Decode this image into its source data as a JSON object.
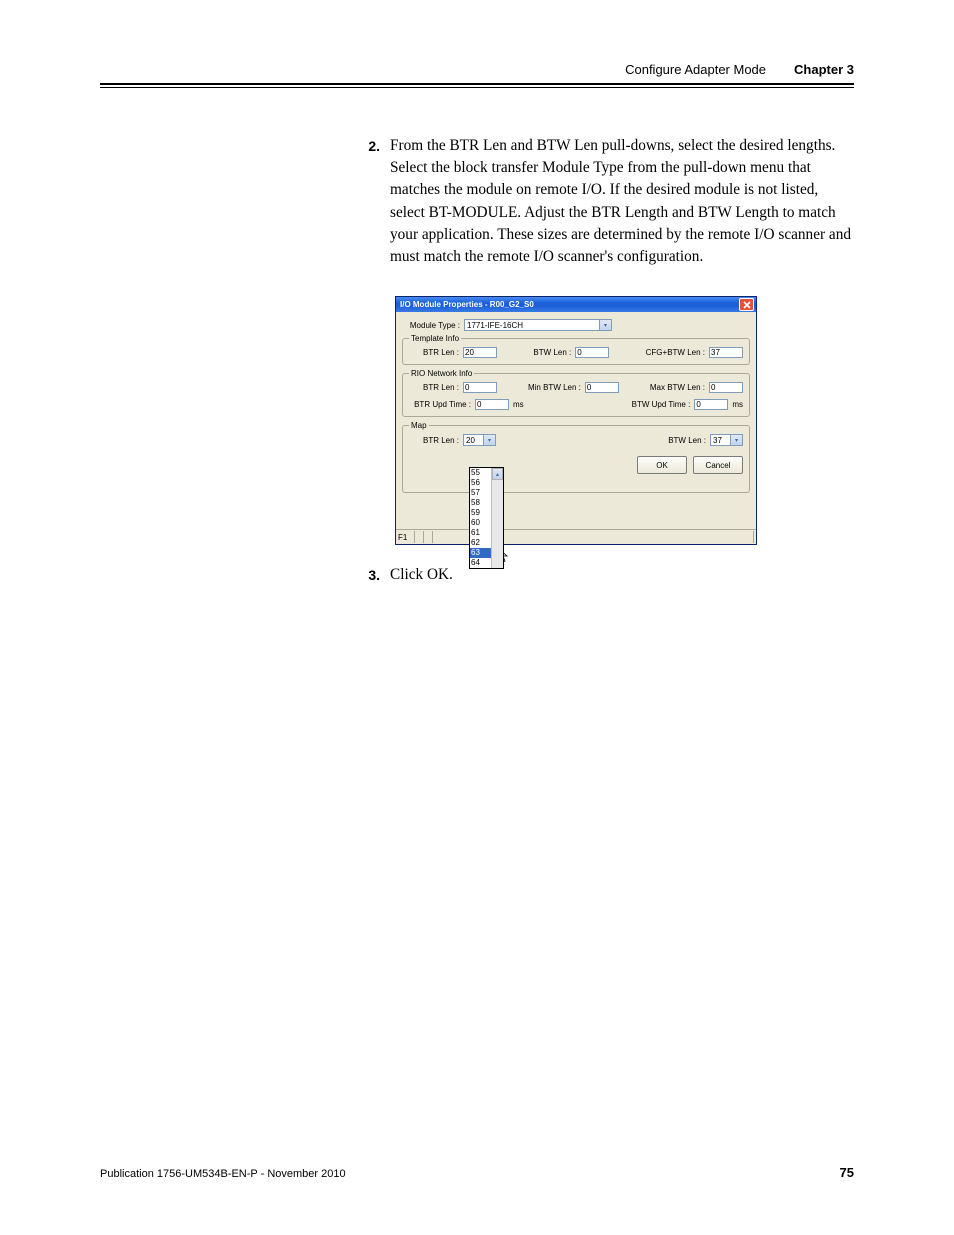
{
  "header": {
    "section_title": "Configure Adapter Mode",
    "chapter_label": "Chapter 3"
  },
  "steps": {
    "two": {
      "num": "2.",
      "text": "From the BTR Len and BTW Len pull-downs, select the desired lengths. Select the block transfer Module Type from the pull-down menu that matches the module on remote I/O. If the desired module is not listed, select BT-MODULE. Adjust the BTR Length and BTW Length to match your application. These sizes are determined by the remote I/O scanner and must match the remote I/O scanner's configuration."
    },
    "three": {
      "num": "3.",
      "text": "Click OK."
    }
  },
  "dialog": {
    "title": "I/O Module Properties - R00_G2_S0",
    "module_type_label": "Module Type :",
    "module_type_value": "1771-IFE-16CH",
    "template": {
      "legend": "Template Info",
      "btr_len_label": "BTR Len :",
      "btr_len_value": "20",
      "btw_len_label": "BTW Len :",
      "btw_len_value": "0",
      "cfg_label": "CFG+BTW Len :",
      "cfg_value": "37"
    },
    "rio": {
      "legend": "RIO Network Info",
      "btr_len_label": "BTR Len :",
      "btr_len_value": "0",
      "min_btw_label": "Min BTW  Len :",
      "min_btw_value": "0",
      "max_btw_label": "Max BTW Len :",
      "max_btw_value": "0",
      "btr_upd_label": "BTR Upd Time :",
      "btr_upd_value": "0",
      "btw_upd_label": "BTW Upd Time :",
      "btw_upd_value": "0",
      "ms": "ms"
    },
    "map": {
      "legend": "Map",
      "btr_len_label": "BTR Len :",
      "btr_len_value": "20",
      "btw_len_label": "BTW Len :",
      "btw_len_value": "37",
      "options": [
        "55",
        "56",
        "57",
        "58",
        "59",
        "60",
        "61",
        "62",
        "63",
        "64"
      ],
      "selected": "63"
    },
    "buttons": {
      "ok": "OK",
      "cancel": "Cancel"
    },
    "status_prefix": "F1"
  },
  "footer": {
    "publication": "Publication 1756-UM534B-EN-P - November 2010",
    "page": "75"
  }
}
